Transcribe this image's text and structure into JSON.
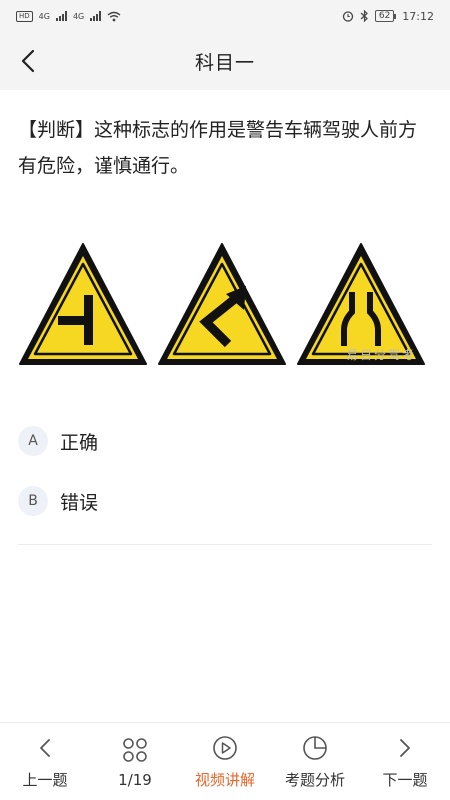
{
  "status_bar": {
    "left_tags": [
      "HD",
      "4G",
      "4G"
    ],
    "battery": "62",
    "time": "17:12"
  },
  "header": {
    "title": "科目一"
  },
  "question": {
    "text": "【判断】这种标志的作用是警告车辆驾驶人前方有危险，谨慎通行。"
  },
  "image": {
    "watermark": "易日分驾考",
    "signs": [
      "t-junction-sign",
      "reverse-curve-sign",
      "road-narrows-sign"
    ]
  },
  "options": [
    {
      "key": "A",
      "text": "正确"
    },
    {
      "key": "B",
      "text": "错误"
    }
  ],
  "bottom_nav": {
    "prev": "上一题",
    "progress": "1/19",
    "video": "视频讲解",
    "analysis": "考题分析",
    "next": "下一题"
  },
  "colors": {
    "accent": "#e8672c",
    "sign_yellow": "#f6d823"
  }
}
